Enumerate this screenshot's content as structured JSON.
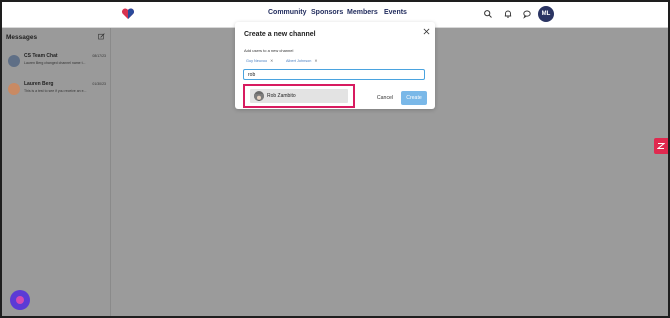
{
  "header": {
    "nav": [
      "Community",
      "Sponsors",
      "Members",
      "Events"
    ],
    "avatar_initials": "ML",
    "icons": [
      "search-icon",
      "bell-icon",
      "chat-icon"
    ]
  },
  "sidebar": {
    "title": "Messages",
    "conversations": [
      {
        "name": "CS Team Chat",
        "date": "08/17/23",
        "preview": "Lauren Berg changed channel name t..."
      },
      {
        "name": "Lauren Berg",
        "date": "01/30/23",
        "preview": "This is a test to see if you receive an e..."
      }
    ]
  },
  "modal": {
    "title": "Create a new channel",
    "label": "Add users to a new channel",
    "chips": [
      "Guy Neuvoo",
      "Albert Johnson"
    ],
    "search_value": "rob",
    "suggestion": "Rob Zambito",
    "cancel_label": "Cancel",
    "create_label": "Create"
  },
  "colors": {
    "brand_navy": "#1f2a5c",
    "highlight": "#d81b60",
    "create_button": "#7ab8e8",
    "chip_text": "#4a7fc1"
  }
}
